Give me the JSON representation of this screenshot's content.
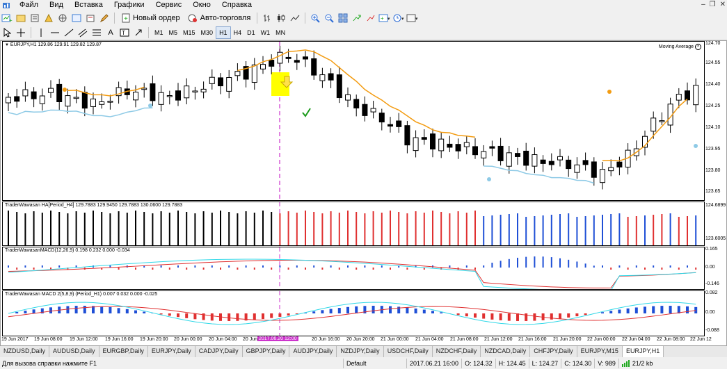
{
  "menu": [
    "Файл",
    "Вид",
    "Вставка",
    "Графики",
    "Сервис",
    "Окно",
    "Справка"
  ],
  "toolbar": {
    "new_order": "Новый ордер",
    "autotrading": "Авто-торговля",
    "timeframes": [
      "M1",
      "M5",
      "M15",
      "M30",
      "H1",
      "H4",
      "D1",
      "W1",
      "MN"
    ],
    "active_timeframe": "H1"
  },
  "chart": {
    "main_label": "EURJPY,H1  129.86 129.91 129.82 129.87",
    "ma_label": "Moving Average",
    "price_ticks": [
      "124.70",
      "124.55",
      "124.40",
      "124.25",
      "124.10",
      "123.95",
      "123.80",
      "123.65"
    ],
    "ha_label": "TraderWawasan HA[Period_H4] 129.7883 129.9450 129.7883 130.0600 129.7883",
    "ha_ticks": [
      "124.6899",
      "123.6005"
    ],
    "macd1_label": "TraderWawasanMACD(12,26,9) 0.198 0.232 0.000 -0.034",
    "macd1_ticks": [
      "0.165",
      "0.00",
      "-0.146"
    ],
    "macd2_label": "TraderWawasan MACD 2(5,8,9) (Period_H1) 0.007 0.032 0.000 -0.025",
    "macd2_ticks": [
      "0.082",
      "0.00",
      "-0.088"
    ],
    "time_ticks": [
      "19 Jun 2017",
      "19 Jun 08:00",
      "19 Jun 12:00",
      "19 Jun 16:00",
      "19 Jun 20:00",
      "20 Jun 00:00",
      "20 Jun 04:00",
      "20 Jun",
      "20 Jun 16:00",
      "20 Jun 20:00",
      "21 Jun 00:00",
      "21 Jun 04:00",
      "21 Jun 08:00",
      "21 Jun 12:00",
      "21 Jun 16:00",
      "21 Jun 20:00",
      "22 Jun 00:00",
      "22 Jun 04:00",
      "22 Jun 08:00",
      "22 Jun 12"
    ],
    "cursor_time": "2017.06.20 12:00"
  },
  "symbol_tabs": [
    "NZDUSD,Daily",
    "AUDUSD,Daily",
    "EURGBP,Daily",
    "EURJPY,Daily",
    "CADJPY,Daily",
    "GBPJPY,Daily",
    "AUDJPY,Daily",
    "NZDJPY,Daily",
    "USDCHF,Daily",
    "NZDCHF,Daily",
    "NZDCAD,Daily",
    "CHFJPY,Daily",
    "EURJPY,M15",
    "EURJPY,H1"
  ],
  "active_tab": "EURJPY,H1",
  "status": {
    "help": "Для вызова справки нажмите F1",
    "profile": "Default",
    "datetime": "2017.06.21 16:00",
    "open": "O: 124.32",
    "high": "H: 124.45",
    "low": "L: 124.27",
    "close": "C: 124.30",
    "volume": "V: 989",
    "traffic": "21/2 kb"
  },
  "colors": {
    "bull": "#ffffff",
    "bear": "#000000",
    "ma_orange": "#f39c12",
    "ma_blue": "#8ecae6",
    "ha_blue": "#1f4fd6",
    "ha_red": "#e03030",
    "macd_cyan": "#30d8e8",
    "macd_red": "#e03030",
    "cursor": "#cc33cc"
  }
}
